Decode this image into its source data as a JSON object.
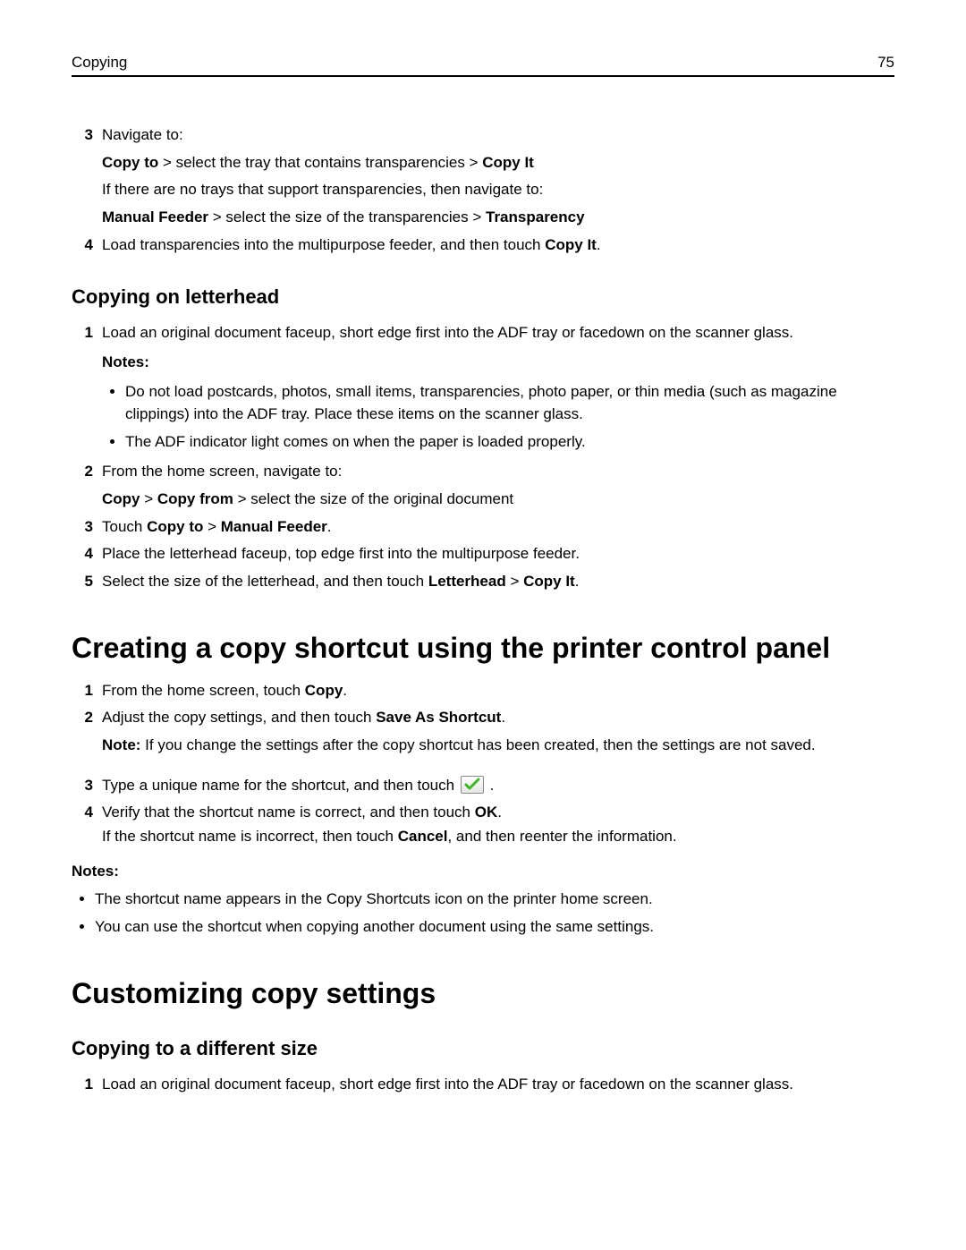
{
  "header": {
    "section": "Copying",
    "page": "75"
  },
  "transparencies": {
    "step3_num": "3",
    "step3_lead": "Navigate to:",
    "step3_l1_a": "Copy to",
    "step3_l1_b": " > select the tray that contains transparencies > ",
    "step3_l1_c": "Copy It",
    "step3_l2": "If there are no trays that support transparencies, then navigate to:",
    "step3_l3_a": "Manual Feeder",
    "step3_l3_b": " > select the size of the transparencies > ",
    "step3_l3_c": "Transparency",
    "step4_num": "4",
    "step4_a": "Load transparencies into the multipurpose feeder, and then touch ",
    "step4_b": "Copy It",
    "step4_c": "."
  },
  "letterhead": {
    "title": "Copying on letterhead",
    "s1_num": "1",
    "s1_text": "Load an original document faceup, short edge first into the ADF tray or facedown on the scanner glass.",
    "notes_label": "Notes:",
    "note_a": "Do not load postcards, photos, small items, transparencies, photo paper, or thin media (such as magazine clippings) into the ADF tray. Place these items on the scanner glass.",
    "note_b": "The ADF indicator light comes on when the paper is loaded properly.",
    "s2_num": "2",
    "s2_lead": "From the home screen, navigate to:",
    "s2_l1_a": "Copy",
    "s2_l1_b": " > ",
    "s2_l1_c": "Copy from",
    "s2_l1_d": " > select the size of the original document",
    "s3_num": "3",
    "s3_a": "Touch ",
    "s3_b": "Copy to",
    "s3_c": " > ",
    "s3_d": "Manual Feeder",
    "s3_e": ".",
    "s4_num": "4",
    "s4_text": "Place the letterhead faceup, top edge first into the multipurpose feeder.",
    "s5_num": "5",
    "s5_a": "Select the size of the letterhead, and then touch ",
    "s5_b": "Letterhead",
    "s5_c": " > ",
    "s5_d": "Copy It",
    "s5_e": "."
  },
  "shortcut": {
    "title": "Creating a copy shortcut using the printer control panel",
    "s1_num": "1",
    "s1_a": "From the home screen, touch ",
    "s1_b": "Copy",
    "s1_c": ".",
    "s2_num": "2",
    "s2_a": "Adjust the copy settings, and then touch ",
    "s2_b": "Save As Shortcut",
    "s2_c": ".",
    "s2_note_a": "Note:",
    "s2_note_b": " If you change the settings after the copy shortcut has been created, then the settings are not saved.",
    "s3_num": "3",
    "s3_a": "Type a unique name for the shortcut, and then touch ",
    "s3_b": ".",
    "s4_num": "4",
    "s4_a": "Verify that the shortcut name is correct, and then touch ",
    "s4_b": "OK",
    "s4_c": ".",
    "s4_l2_a": "If the shortcut name is incorrect, then touch ",
    "s4_l2_b": "Cancel",
    "s4_l2_c": ", and then reenter the information.",
    "notes_label": "Notes:",
    "note_a": "The shortcut name appears in the Copy Shortcuts icon on the printer home screen.",
    "note_b": "You can use the shortcut when copying another document using the same settings."
  },
  "customize": {
    "title": "Customizing copy settings",
    "sub_title": "Copying to a different size",
    "s1_num": "1",
    "s1_text": "Load an original document faceup, short edge first into the ADF tray or facedown on the scanner glass."
  }
}
